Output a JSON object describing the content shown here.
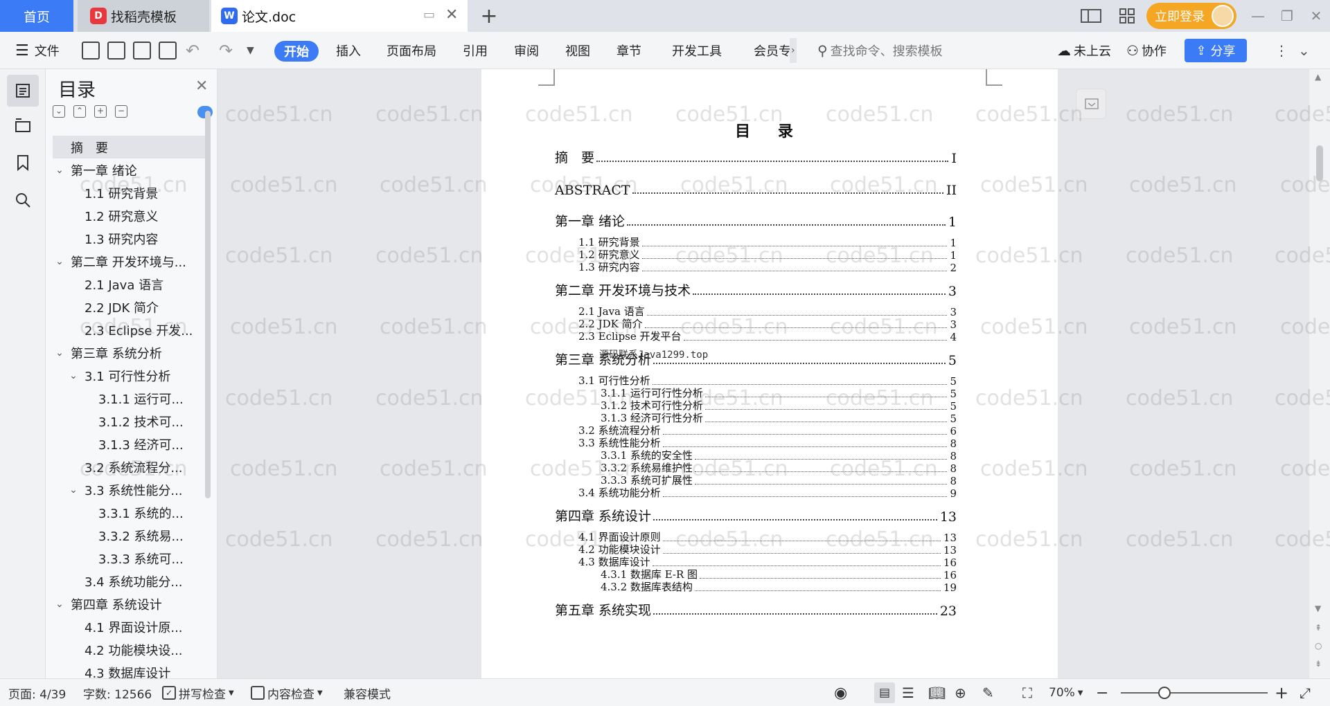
{
  "tabs": {
    "home": "首页",
    "templates": "找稻壳模板",
    "doc": "论文.doc",
    "login": "立即登录"
  },
  "ribbon": {
    "file": "文件",
    "items": [
      "开始",
      "插入",
      "页面布局",
      "引用",
      "审阅",
      "视图",
      "章节",
      "开发工具",
      "会员专"
    ],
    "search_placeholder": "查找命令、搜索模板",
    "cloud": "未上云",
    "collab": "协作",
    "share": "分享"
  },
  "toc_panel": {
    "title": "目录",
    "items": [
      {
        "label": "摘　要",
        "level": 0,
        "chevron": "",
        "selected": true
      },
      {
        "label": "第一章  绪论",
        "level": 0,
        "chevron": "v"
      },
      {
        "label": "1.1 研究背景",
        "level": 1,
        "chevron": ""
      },
      {
        "label": "1.2 研究意义",
        "level": 1,
        "chevron": ""
      },
      {
        "label": "1.3 研究内容",
        "level": 1,
        "chevron": ""
      },
      {
        "label": "第二章  开发环境与...",
        "level": 0,
        "chevron": "v"
      },
      {
        "label": "2.1 Java 语言",
        "level": 1,
        "chevron": ""
      },
      {
        "label": "2.2 JDK 简介",
        "level": 1,
        "chevron": ""
      },
      {
        "label": "2.3 Eclipse 开发...",
        "level": 1,
        "chevron": ""
      },
      {
        "label": "第三章  系统分析",
        "level": 0,
        "chevron": "v"
      },
      {
        "label": "3.1 可行性分析",
        "level": 1,
        "chevron": "v"
      },
      {
        "label": "3.1.1 运行可...",
        "level": 2,
        "chevron": ""
      },
      {
        "label": "3.1.2 技术可...",
        "level": 2,
        "chevron": ""
      },
      {
        "label": "3.1.3 经济可...",
        "level": 2,
        "chevron": ""
      },
      {
        "label": "3.2 系统流程分...",
        "level": 1,
        "chevron": ""
      },
      {
        "label": "3.3  系统性能分...",
        "level": 1,
        "chevron": "v"
      },
      {
        "label": "3.3.1 系统的...",
        "level": 2,
        "chevron": ""
      },
      {
        "label": "3.3.2 系统易...",
        "level": 2,
        "chevron": ""
      },
      {
        "label": "3.3.3 系统可...",
        "level": 2,
        "chevron": ""
      },
      {
        "label": "3.4 系统功能分...",
        "level": 1,
        "chevron": ""
      },
      {
        "label": "第四章  系统设计",
        "level": 0,
        "chevron": "v"
      },
      {
        "label": "4.1 界面设计原...",
        "level": 1,
        "chevron": ""
      },
      {
        "label": "4.2 功能模块设...",
        "level": 1,
        "chevron": ""
      },
      {
        "label": "4.3 数据库设计",
        "level": 1,
        "chevron": ""
      }
    ]
  },
  "document": {
    "heading": "目 录",
    "overlay": "源码联系Java1299.top",
    "entries": [
      {
        "text": "摘　要",
        "page": "I",
        "level": 0
      },
      {
        "text": "ABSTRACT",
        "page": "II",
        "level": 0
      },
      {
        "text": "第一章  绪论",
        "page": "1",
        "level": 0
      },
      {
        "text": "1.1  研究背景",
        "page": "1",
        "level": 1
      },
      {
        "text": "1.2  研究意义",
        "page": "1",
        "level": 1
      },
      {
        "text": "1.3  研究内容",
        "page": "2",
        "level": 1
      },
      {
        "text": "第二章  开发环境与技术",
        "page": "3",
        "level": 0
      },
      {
        "text": "2.1 Java 语言",
        "page": "3",
        "level": 1
      },
      {
        "text": "2.2 JDK 简介",
        "page": "3",
        "level": 1
      },
      {
        "text": "2.3 Eclipse 开发平台",
        "page": "4",
        "level": 1
      },
      {
        "text": "第三章  系统分析",
        "page": "5",
        "level": 0
      },
      {
        "text": "3.1  可行性分析",
        "page": "5",
        "level": 1
      },
      {
        "text": "3.1.1  运行可行性分析",
        "page": "5",
        "level": 2
      },
      {
        "text": "3.1.2  技术可行性分析",
        "page": "5",
        "level": 2
      },
      {
        "text": "3.1.3  经济可行性分析",
        "page": "5",
        "level": 2
      },
      {
        "text": "3.2  系统流程分析",
        "page": "6",
        "level": 1
      },
      {
        "text": "3.3  系统性能分析",
        "page": "8",
        "level": 1
      },
      {
        "text": "3.3.1  系统的安全性",
        "page": "8",
        "level": 2
      },
      {
        "text": "3.3.2  系统易维护性",
        "page": "8",
        "level": 2
      },
      {
        "text": "3.3.3  系统可扩展性",
        "page": "8",
        "level": 2
      },
      {
        "text": "3.4  系统功能分析",
        "page": "9",
        "level": 1
      },
      {
        "text": "第四章  系统设计",
        "page": "13",
        "level": 0
      },
      {
        "text": "4.1  界面设计原则",
        "page": "13",
        "level": 1
      },
      {
        "text": "4.2  功能模块设计",
        "page": "13",
        "level": 1
      },
      {
        "text": "4.3  数据库设计",
        "page": "16",
        "level": 1
      },
      {
        "text": "4.3.1  数据库 E-R 图",
        "page": "16",
        "level": 2
      },
      {
        "text": "4.3.2   数据库表结构",
        "page": "19",
        "level": 2
      },
      {
        "text": "第五章  系统实现",
        "page": "23",
        "level": 0
      }
    ]
  },
  "status": {
    "page": "页面: 4/39",
    "words": "字数: 12566",
    "spell": "拼写检查",
    "content_check": "内容检查",
    "compat": "兼容模式",
    "zoom": "70%"
  },
  "watermark": "code51.cn",
  "colors": {
    "accent": "#3b7cf6",
    "login": "#f5a623"
  }
}
